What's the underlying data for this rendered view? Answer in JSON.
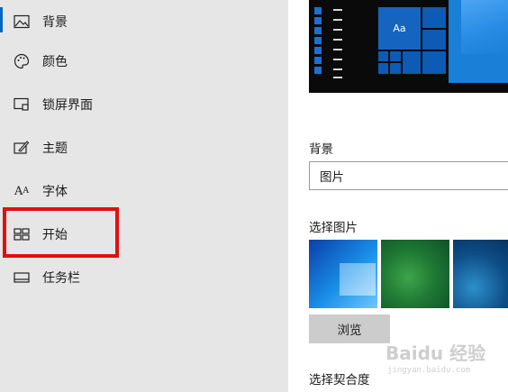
{
  "sidebar": {
    "items": [
      {
        "label": "背景",
        "icon": "image-icon",
        "active": true
      },
      {
        "label": "颜色",
        "icon": "palette-icon"
      },
      {
        "label": "锁屏界面",
        "icon": "lock-screen-icon"
      },
      {
        "label": "主题",
        "icon": "theme-brush-icon"
      },
      {
        "label": "字体",
        "icon": "font-icon"
      },
      {
        "label": "开始",
        "icon": "start-tiles-icon",
        "highlighted": true
      },
      {
        "label": "任务栏",
        "icon": "taskbar-icon"
      }
    ],
    "accent_color": "#0067c0",
    "highlight_color": "#e01010"
  },
  "preview": {
    "tile_label": "Aa"
  },
  "main": {
    "background_label": "背景",
    "background_dropdown_value": "图片",
    "choose_picture_label": "选择图片",
    "browse_button": "浏览",
    "choose_fit_label": "选择契合度"
  },
  "watermark": {
    "text": "Baidu 经验",
    "url": "jingyan.baidu.com"
  }
}
